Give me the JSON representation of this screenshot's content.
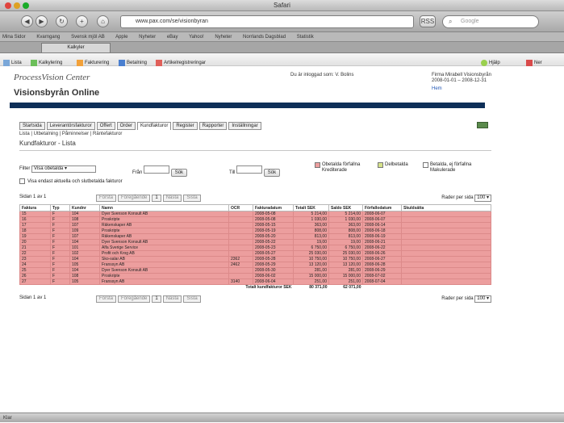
{
  "window": {
    "title": "Safari"
  },
  "nav": {
    "url": "www.pax.com/se/visionbyran",
    "search_placeholder": "Google"
  },
  "bookmarks": [
    "Mina Sidor",
    "Kvarngang",
    "Svensk mjöl AB",
    "Apple",
    "Nyheter",
    "eBay",
    "Yahoo!",
    "Nyheter",
    "Norrlands Dagsblad",
    "Statistik"
  ],
  "tab": {
    "label": "Kalkyler"
  },
  "toolbar": {
    "items": [
      "Lista",
      "Kalkylering",
      "Fakturering",
      "Betalning",
      "Artikelregistreringar"
    ],
    "help": "Hjälp",
    "logout": "Ner"
  },
  "header": {
    "logo": "ProcessVision Center",
    "app_title": "Visionsbyrån Online",
    "logged_in": "Du är inloggad som: V. Bolins",
    "company_line1": "Firma Mirabell Visionsbyrån",
    "company_line2": "2008-01-01 – 2008-12-31",
    "company_link": "Hem"
  },
  "main_tabs": [
    "Startsida",
    "Leverantörsfakturor",
    "Offert",
    "Order",
    "Kundfakturor",
    "Register",
    "Rapporter",
    "Inställningar"
  ],
  "sub_tabs": "Lista | Utbetalning | Påminnelser | Räntefakturor",
  "page_title": "Kundfakturor - Lista",
  "filter": {
    "label": "Filter",
    "select_value": "Visa obetalda",
    "from_label": "Från",
    "to_label": "Till",
    "button": "Sök",
    "checkbox_label": "Visa endast aktuella och slutbetalda fakturor"
  },
  "legends": {
    "overdue": "Obetalda förfallna",
    "overdue_sub": "Krediterade",
    "partial": "Delbetalda",
    "paid": "Betalda, ej förfallna",
    "paid_sub": "Makulerade"
  },
  "pager": {
    "label": "Sidan 1 av 1",
    "buttons": [
      "Första",
      "Föregående",
      "1",
      "Nästa",
      "Sista"
    ],
    "rows_label": "Rader per sida",
    "rows_value": "100"
  },
  "table": {
    "headers": [
      "Faktura",
      "Typ",
      "Kundnr",
      "Namn",
      "OCR",
      "Fakturadatum",
      "Totalt SEK",
      "Saldo SEK",
      "Förfallodatum",
      "Skuldsätta"
    ],
    "rows": [
      [
        "15",
        "F",
        "104",
        "Dyer Svenson Konsult AB",
        "",
        "2008-05-08",
        "5 214,00",
        "5 214,00",
        "2008-06-07",
        ""
      ],
      [
        "16",
        "F",
        "108",
        "Proskripte",
        "",
        "2008-05-08",
        "1 030,00",
        "1 030,00",
        "2008-06-07",
        ""
      ],
      [
        "17",
        "F",
        "107",
        "Räkenskaper AB",
        "",
        "2008-05-15",
        "363,00",
        "363,00",
        "2008-06-14",
        ""
      ],
      [
        "18",
        "F",
        "109",
        "Proskripte",
        "",
        "2008-05-19",
        "808,00",
        "808,00",
        "2008-06-18",
        ""
      ],
      [
        "19",
        "F",
        "107",
        "Räkenskaper AB",
        "",
        "2008-05-20",
        "813,00",
        "813,00",
        "2008-06-19",
        ""
      ],
      [
        "20",
        "F",
        "104",
        "Dyer Svenson Konsult AB",
        "",
        "2008-05-22",
        "19,00",
        "19,00",
        "2008-06-21",
        ""
      ],
      [
        "21",
        "F",
        "101",
        "Alfa Sverige Service",
        "",
        "2008-05-23",
        "6 750,00",
        "6 750,00",
        "2008-06-22",
        ""
      ],
      [
        "22",
        "F",
        "102",
        "Profit och Krog AB",
        "",
        "2008-05-27",
        "25 030,00",
        "25 030,00",
        "2008-06-26",
        ""
      ],
      [
        "23",
        "F",
        "104",
        "Sko-salar AB",
        "2362",
        "2008-05-28",
        "10 750,00",
        "10 750,00",
        "2008-06-27",
        ""
      ],
      [
        "24",
        "F",
        "105",
        "Franssyn AB",
        "2462",
        "2008-05-29",
        "13 120,00",
        "13 120,00",
        "2008-06-28",
        ""
      ],
      [
        "25",
        "F",
        "104",
        "Dyer Svenson Konsult AB",
        "",
        "2008-05-30",
        "281,00",
        "281,00",
        "2008-06-29",
        ""
      ],
      [
        "26",
        "F",
        "108",
        "Proskripte",
        "",
        "2008-06-02",
        "15 000,00",
        "15 000,00",
        "2008-07-02",
        ""
      ],
      [
        "27",
        "F",
        "105",
        "Franssyn AB",
        "3140",
        "2008-06-04",
        "251,00",
        "251,00",
        "2008-07-04",
        ""
      ]
    ],
    "total_label": "Totalt kundfakturor SEK",
    "total_amount": "80 371,00",
    "total_balance": "62 071,00"
  },
  "status": {
    "text": "Klar"
  }
}
